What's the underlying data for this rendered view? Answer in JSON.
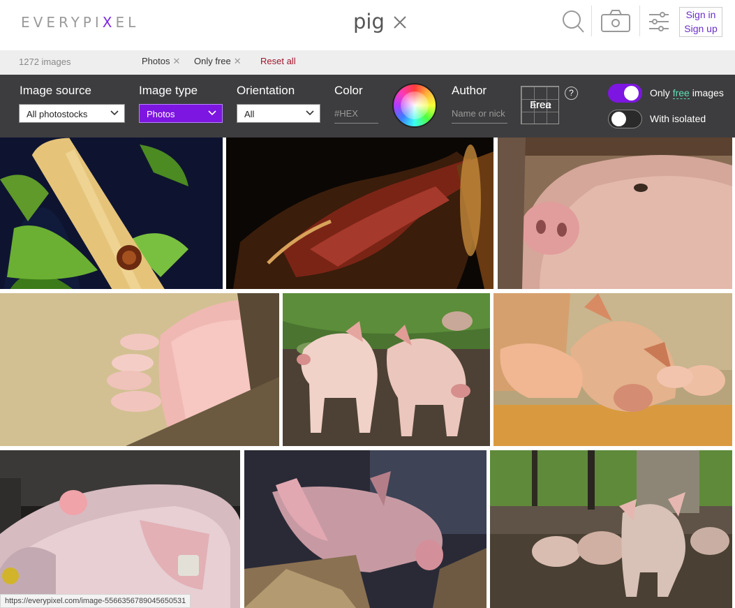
{
  "header": {
    "logo": {
      "before": "EVERYPI",
      "mid": "X",
      "after": "EL"
    },
    "query": "pig",
    "sign_in": "Sign in",
    "sign_up": "Sign up"
  },
  "filterbar": {
    "count": "1272 images",
    "chips": [
      "Photos",
      "Only free"
    ],
    "reset": "Reset all"
  },
  "panel": {
    "image_source": {
      "label": "Image source",
      "value": "All photostocks"
    },
    "image_type": {
      "label": "Image type",
      "value": "Photos"
    },
    "orientation": {
      "label": "Orientation",
      "value": "All"
    },
    "color": {
      "label": "Color",
      "placeholder": "#HEX"
    },
    "author": {
      "label": "Author",
      "placeholder": "Name or nick"
    },
    "free_area": {
      "line1": "Free",
      "line2": "area"
    },
    "help": "?",
    "only_free": {
      "before": "Only",
      "free": "free",
      "after": "images",
      "on": true
    },
    "isolated": {
      "label": "With isolated",
      "on": false
    }
  },
  "colors": {
    "accent": "#7d16e0",
    "reset": "#a0152a",
    "panel": "#3d3d3f"
  },
  "images": [
    {
      "name": "sausage-roll-photo"
    },
    {
      "name": "cured-ham-photo"
    },
    {
      "name": "pig-face-photo"
    },
    {
      "name": "sow-nursing-piglets-photo"
    },
    {
      "name": "two-piglets-photo"
    },
    {
      "name": "sow-with-piglets-photo"
    },
    {
      "name": "sleeping-pig-photo"
    },
    {
      "name": "pig-in-pen-photo"
    },
    {
      "name": "piglets-in-forest-photo"
    }
  ],
  "status_url": "https://everypixel.com/image-5566356789045650531"
}
